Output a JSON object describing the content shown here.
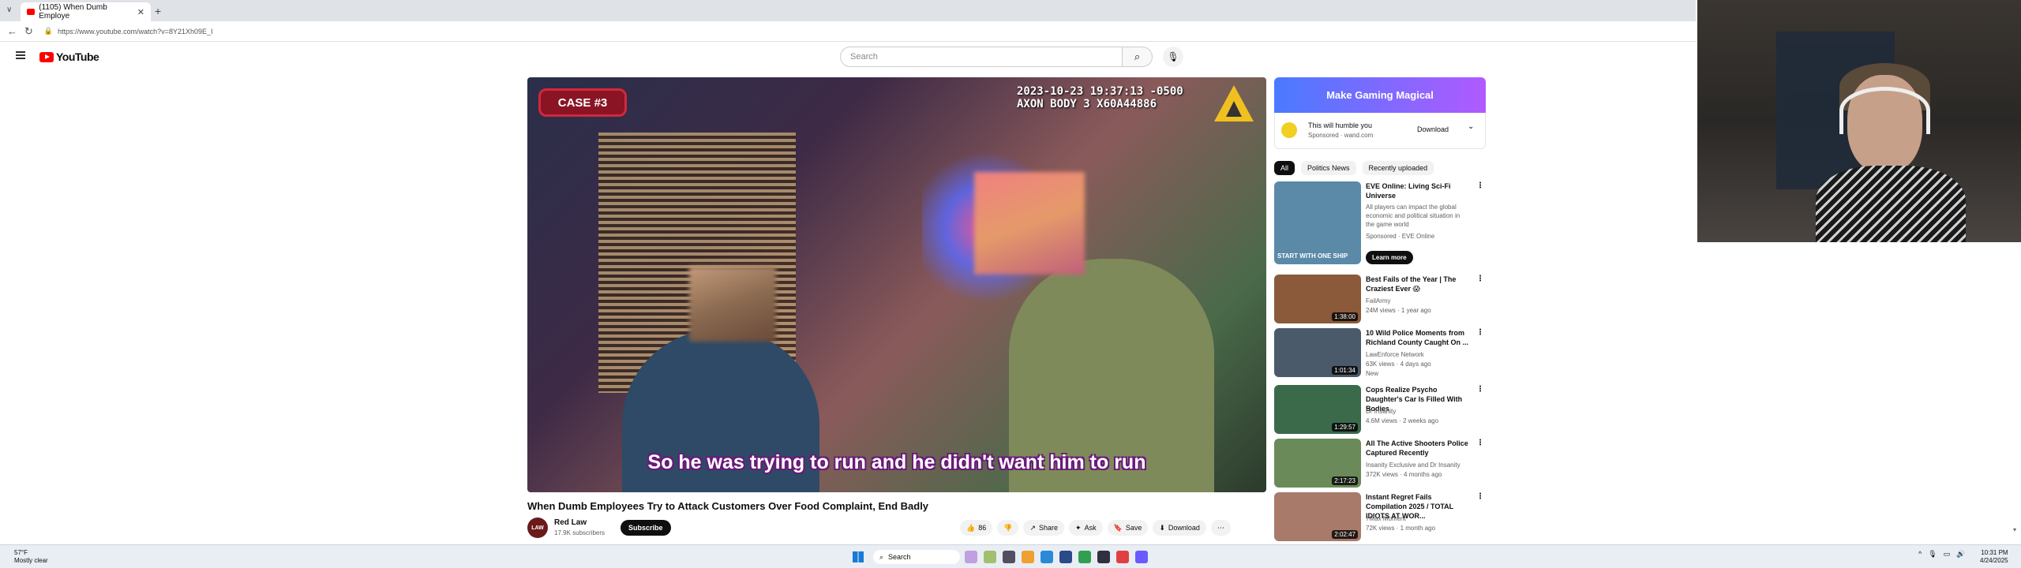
{
  "browser": {
    "tab_title": "(1105) When Dumb Employe",
    "url": "https://www.youtube.com/watch?v=8Y21Xh09E_I"
  },
  "youtube": {
    "logo": "YouTube",
    "search_placeholder": "Search"
  },
  "video": {
    "case_badge": "CASE #3",
    "cam_line1": "2023-10-23 19:37:13 -0500",
    "cam_line2": "AXON BODY 3 X60A44886",
    "subtitle": "So he was trying to run and he didn't want him to run",
    "title": "When Dumb Employees Try to Attack Customers Over Food Complaint, End Badly",
    "channel": "Red Law",
    "subscribers": "17.9K subscribers",
    "avatar_text": "LAW",
    "subscribe_label": "Subscribe",
    "likes": "86",
    "share_label": "Share",
    "ask_label": "Ask",
    "save_label": "Save",
    "download_label": "Download"
  },
  "ad": {
    "banner": "Make Gaming Magical",
    "line1": "This will humble you",
    "line2": "Sponsored · wand.com",
    "download_label": "Download"
  },
  "chips": [
    "All",
    "Politics News",
    "Recently uploaded"
  ],
  "recommendations": [
    {
      "title": "EVE Online: Living Sci-Fi Universe",
      "meta1": "All players can impact the global economic and political situation in the game world",
      "meta2": "Sponsored · EVE Online",
      "duration": "",
      "thumb_text": "START WITH ONE SHIP",
      "thumb_color": "#5a8aa8",
      "learn_more": "Learn more"
    },
    {
      "title": "Best Fails of the Year | The Craziest Ever 😱",
      "meta1": "FailArmy",
      "meta2": "24M views · 1 year ago",
      "duration": "1:38:00",
      "thumb_color": "#8a5a3a"
    },
    {
      "title": "10 Wild Police Moments from Richland County Caught On ...",
      "meta1": "LawEnforce Network",
      "meta2": "63K views · 4 days ago",
      "meta3": "New",
      "duration": "1:01:34",
      "thumb_color": "#4a5a6a"
    },
    {
      "title": "Cops Realize Psycho Daughter's Car Is Filled With Bodies",
      "meta1": "Dr Insanity",
      "meta2": "4.6M views · 2 weeks ago",
      "duration": "1:29:57",
      "thumb_color": "#3a6a4a"
    },
    {
      "title": "All The Active Shooters Police Captured Recently",
      "meta1": "Insanity Exclusive and Dr Insanity",
      "meta2": "372K views · 4 months ago",
      "duration": "2:17:23",
      "thumb_color": "#6a8a5a"
    },
    {
      "title": "Instant Regret Fails Compilation 2025 / TOTAL IDIOTS AT WOR...",
      "meta1": "7Max Moment",
      "meta2": "72K views · 1 month ago",
      "duration": "2:02:47",
      "thumb_color": "#a87a6a"
    }
  ],
  "taskbar": {
    "temp": "57°F",
    "weather": "Mostly clear",
    "search": "Search",
    "time": "10:31 PM",
    "date": "4/24/2025"
  }
}
